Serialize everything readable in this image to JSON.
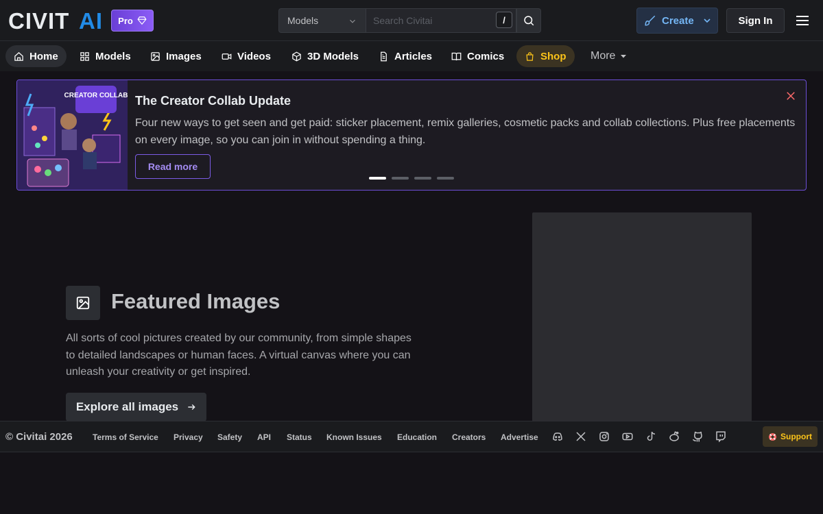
{
  "header": {
    "logo_text": "CIVITAI",
    "pro_label": "Pro",
    "search": {
      "category": "Models",
      "placeholder": "Search Civitai",
      "shortcut": "/"
    },
    "create_label": "Create",
    "signin_label": "Sign In"
  },
  "nav": {
    "items": [
      {
        "label": "Home",
        "icon": "home-icon"
      },
      {
        "label": "Models",
        "icon": "models-icon"
      },
      {
        "label": "Images",
        "icon": "image-icon"
      },
      {
        "label": "Videos",
        "icon": "video-icon"
      },
      {
        "label": "3D Models",
        "icon": "cube-icon"
      },
      {
        "label": "Articles",
        "icon": "article-icon"
      },
      {
        "label": "Comics",
        "icon": "book-icon"
      },
      {
        "label": "Shop",
        "icon": "shopping-bag-icon"
      }
    ],
    "more_label": "More"
  },
  "banner": {
    "image_text": "CREATOR COLLAB",
    "title": "The Creator Collab Update",
    "text": "Four new ways to get seen and get paid: sticker placement, remix galleries, cosmetic packs and collab collections. Plus free placements on every image, so you can join in without spending a thing.",
    "read_more_label": "Read more",
    "slides_total": 4,
    "active_slide": 1
  },
  "featured": {
    "title": "Featured Images",
    "description": "All sorts of cool pictures created by our community, from simple shapes to detailed landscapes or human faces. A virtual canvas where you can unleash your creativity or get inspired.",
    "button_label": "Explore all images"
  },
  "footer": {
    "copyright": "© Civitai 2026",
    "links": [
      "Terms of Service",
      "Privacy",
      "Safety",
      "API",
      "Status",
      "Known Issues",
      "Education",
      "Creators",
      "Advertise"
    ],
    "social_icons": [
      "discord-icon",
      "x-icon",
      "instagram-icon",
      "youtube-icon",
      "tiktok-icon",
      "reddit-icon",
      "github-icon",
      "twitch-icon"
    ],
    "support_label": "Support"
  },
  "colors": {
    "background": "#141217",
    "accent_purple": "#7c5ce6",
    "create_blue": "#74b6f5",
    "shop_yellow": "#fcc419"
  }
}
